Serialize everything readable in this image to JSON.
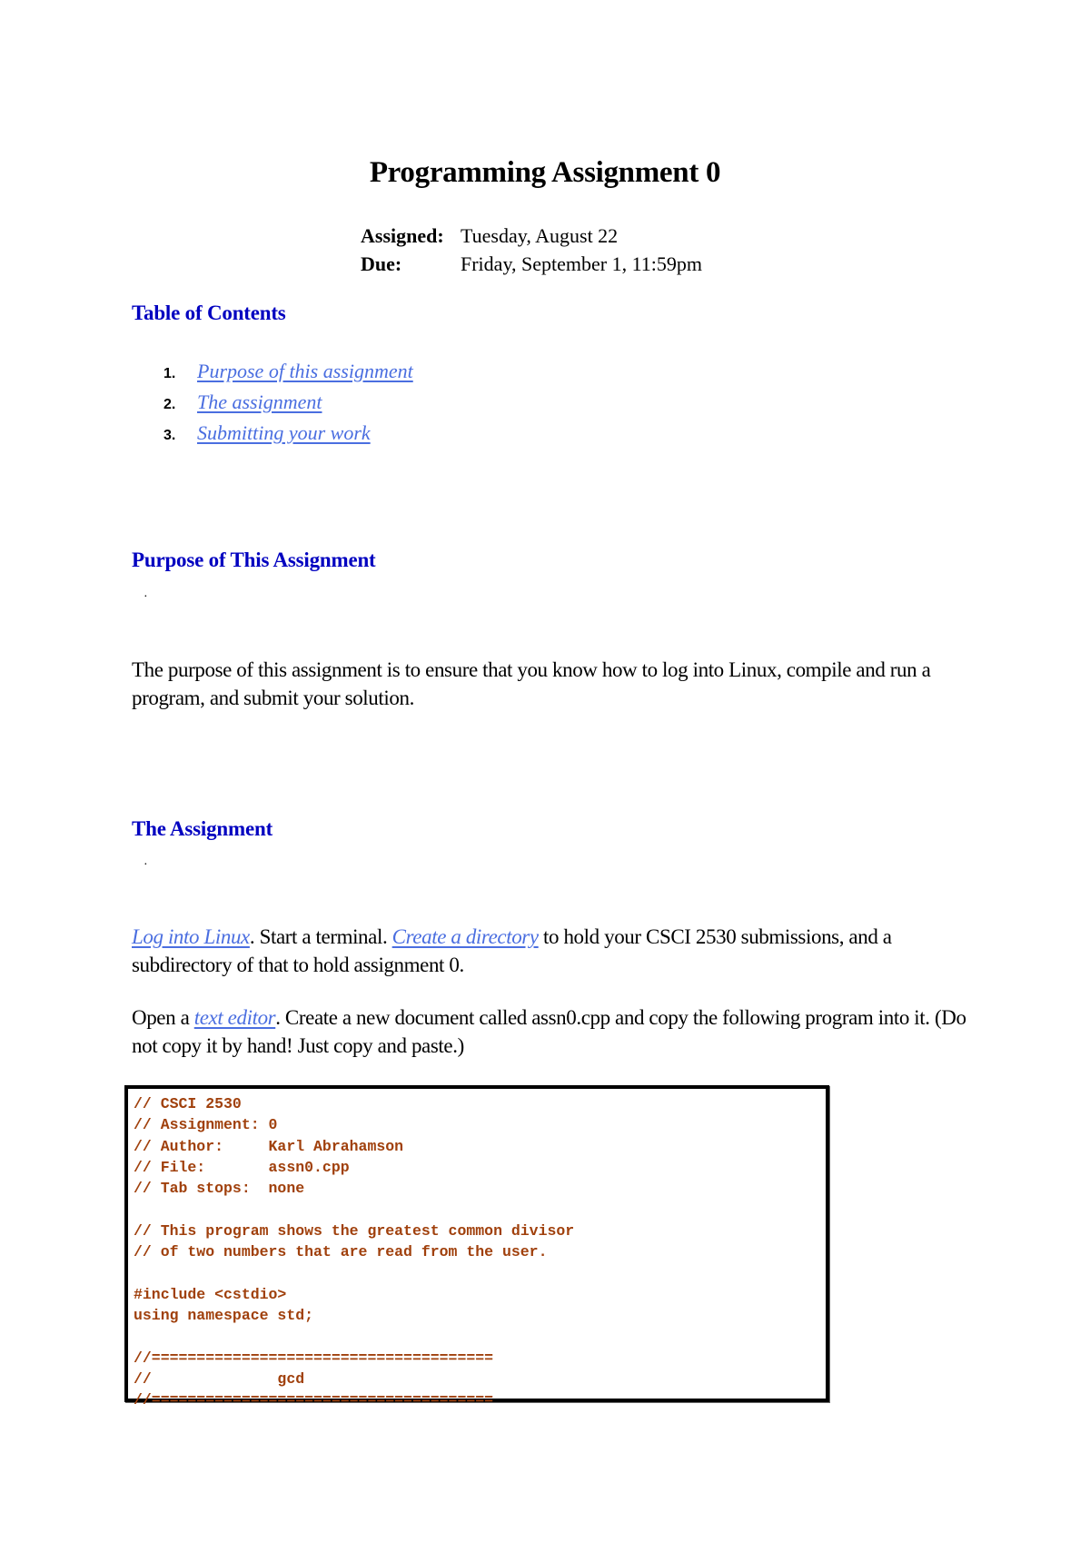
{
  "document": {
    "title": "Programming Assignment 0",
    "meta": [
      {
        "label": "Assigned:",
        "value": "Tuesday, August 22"
      },
      {
        "label": "Due:",
        "value": "Friday, September 1, 11:59pm"
      }
    ],
    "colors": {
      "heading": "#0000c0",
      "link": "#4a6ee0",
      "code": "#a0400c",
      "text": "#000000"
    },
    "toc": {
      "heading": "Table of Contents",
      "items": [
        {
          "number": "1.",
          "label": "Purpose of this assignment"
        },
        {
          "number": "2.",
          "label": "The assignment"
        },
        {
          "number": "3.",
          "label": "Submitting your work"
        }
      ]
    },
    "purpose": {
      "heading": "Purpose of This Assignment",
      "marker": "·",
      "text": "The purpose of this assignment is to ensure that you know how to log into Linux, compile and run a program, and submit your solution."
    },
    "assignment": {
      "heading": "The Assignment",
      "marker": "·",
      "para1": {
        "link1": "Log into Linux",
        "text1": ". Start a terminal. ",
        "link2": "Create a directory",
        "text2": " to hold your CSCI 2530 submissions, and a subdirectory of that to hold assignment 0."
      },
      "para2": {
        "text1": "Open a ",
        "link1": "text editor",
        "text2": ". Create a new document called assn0.cpp and copy the following program into it. (Do not copy it by hand! Just copy and paste.)"
      },
      "code_lines": [
        "// CSCI 2530",
        "// Assignment: 0",
        "// Author:     Karl Abrahamson",
        "// File:       assn0.cpp",
        "// Tab stops:  none",
        "",
        "// This program shows the greatest common divisor",
        "// of two numbers that are read from the user.",
        "",
        "#include <cstdio>",
        "using namespace std;",
        "",
        "//======================================",
        "//              gcd",
        "//======================================"
      ]
    }
  }
}
